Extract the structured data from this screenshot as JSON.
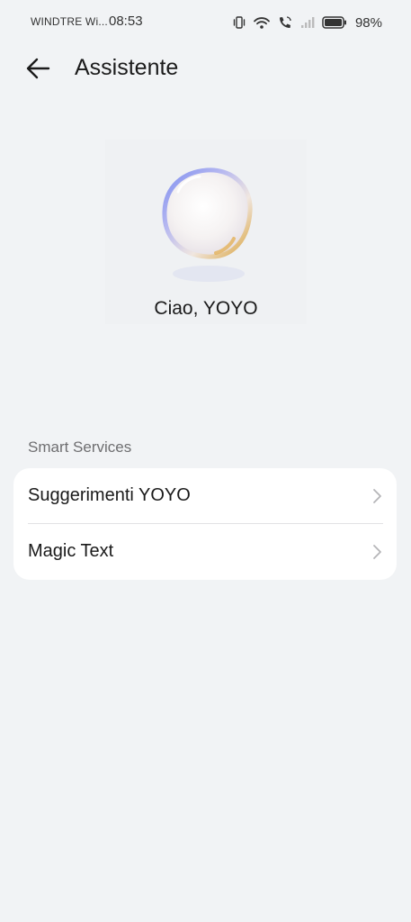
{
  "status_bar": {
    "carrier": "WINDTRE Wi...",
    "time": "08:53",
    "battery": "98%",
    "icons": [
      "vibrate-icon",
      "wifi-icon",
      "wifi-call-icon",
      "signal-icon",
      "battery-icon"
    ]
  },
  "header": {
    "title": "Assistente",
    "back_icon": "arrow-left-icon"
  },
  "hero": {
    "greeting": "Ciao, YOYO"
  },
  "smart_services": {
    "section_title": "Smart Services",
    "items": [
      {
        "label": "Suggerimenti YOYO"
      },
      {
        "label": "Magic Text"
      }
    ]
  },
  "colors": {
    "background": "#f1f3f5",
    "card": "#ffffff",
    "section_text": "#6e6e70",
    "chevron": "#b5b5b8"
  }
}
